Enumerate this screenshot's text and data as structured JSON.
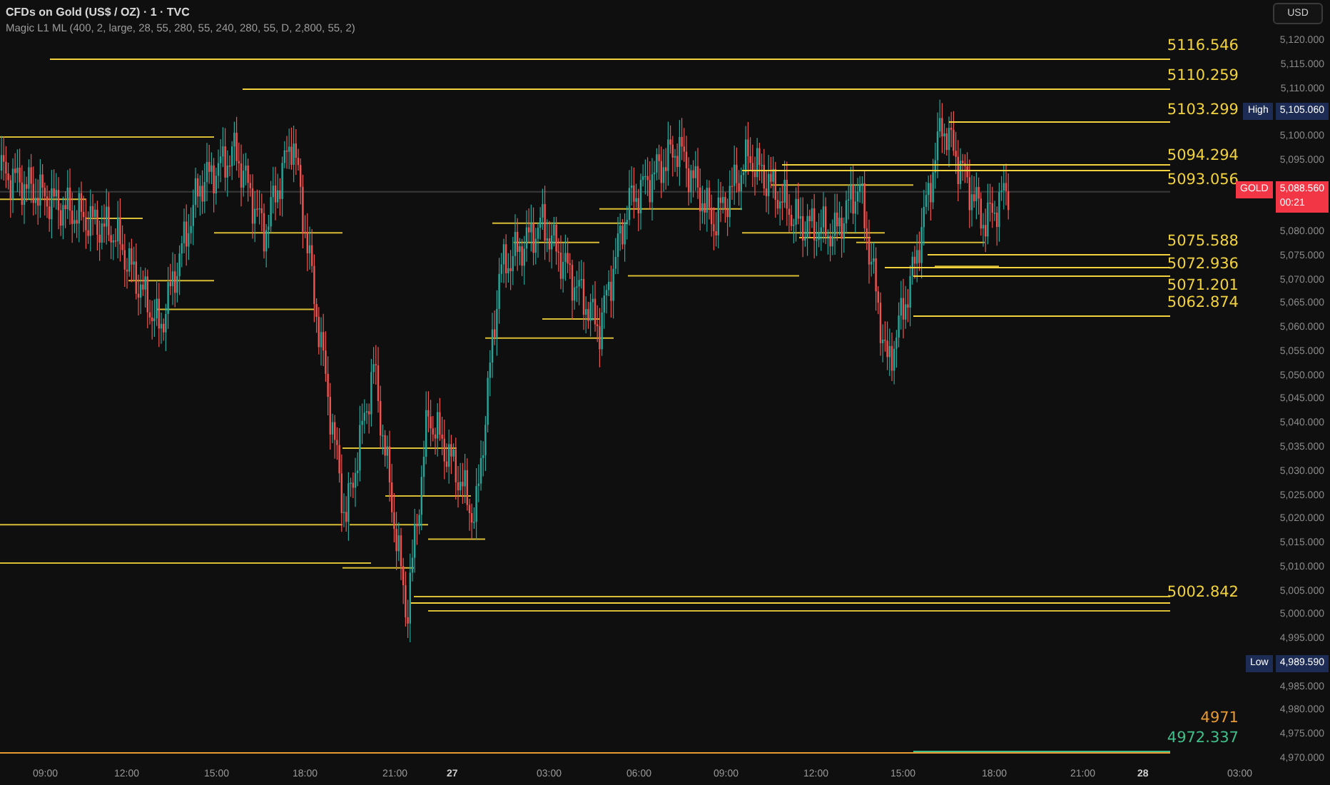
{
  "header": {
    "title": "CFDs on Gold (US$ / OZ) · 1 · TVC",
    "indicator": "Magic L1 ML (400, 2, large, 28, 55, 280, 55, 240, 280, 55, D, 2,800, 55, 2)"
  },
  "currency_button": "USD",
  "levels": [
    {
      "label": "5116.546",
      "color": "#f2d23c"
    },
    {
      "label": "5110.259",
      "color": "#f2d23c"
    },
    {
      "label": "5103.299",
      "color": "#f2d23c"
    },
    {
      "label": "5094.294",
      "color": "#f2d23c"
    },
    {
      "label": "5093.056",
      "color": "#f2d23c"
    },
    {
      "label": "5075.588",
      "color": "#f2d23c"
    },
    {
      "label": "5072.936",
      "color": "#f2d23c"
    },
    {
      "label": "5071.201",
      "color": "#f2d23c"
    },
    {
      "label": "5062.874",
      "color": "#f2d23c"
    },
    {
      "label": "5002.842",
      "color": "#f2d23c"
    },
    {
      "label": "4971",
      "color": "#e89a32"
    },
    {
      "label": "4972.337",
      "color": "#3fbf8a"
    }
  ],
  "price_axis": [
    "5,120.000",
    "5,115.000",
    "5,110.000",
    "5,100.000",
    "5,095.000",
    "5,080.000",
    "5,075.000",
    "5,070.000",
    "5,065.000",
    "5,060.000",
    "5,055.000",
    "5,050.000",
    "5,045.000",
    "5,040.000",
    "5,035.000",
    "5,030.000",
    "5,025.000",
    "5,020.000",
    "5,015.000",
    "5,010.000",
    "5,005.000",
    "5,000.000",
    "4,995.000",
    "4,985.000",
    "4,980.000",
    "4,975.000",
    "4,970.000"
  ],
  "markers": [
    {
      "kind": "high",
      "label": "High",
      "value": "5,105.060"
    },
    {
      "kind": "last",
      "label": "GOLD",
      "value": "5,088.560",
      "countdown": "00:21"
    },
    {
      "kind": "low",
      "label": "Low",
      "value": "4,989.590"
    }
  ],
  "time_axis": [
    {
      "label": "09:00",
      "kind": "time"
    },
    {
      "label": "12:00",
      "kind": "time"
    },
    {
      "label": "15:00",
      "kind": "time"
    },
    {
      "label": "18:00",
      "kind": "time"
    },
    {
      "label": "21:00",
      "kind": "time"
    },
    {
      "label": "27",
      "kind": "day"
    },
    {
      "label": "03:00",
      "kind": "time"
    },
    {
      "label": "06:00",
      "kind": "time"
    },
    {
      "label": "09:00",
      "kind": "time"
    },
    {
      "label": "12:00",
      "kind": "time"
    },
    {
      "label": "15:00",
      "kind": "time"
    },
    {
      "label": "18:00",
      "kind": "time"
    },
    {
      "label": "21:00",
      "kind": "time"
    },
    {
      "label": "28",
      "kind": "day"
    },
    {
      "label": "03:00",
      "kind": "time"
    }
  ]
}
